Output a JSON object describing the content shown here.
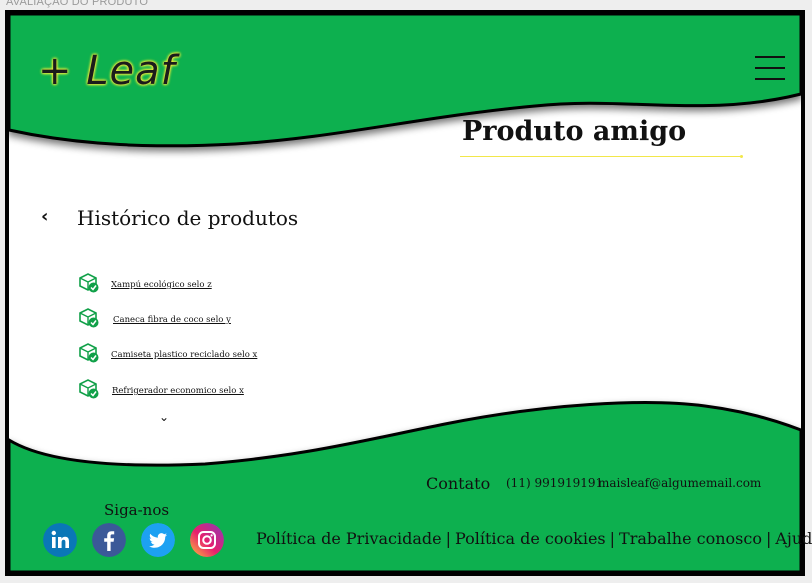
{
  "caption": "AVALIAÇÃO DO PRODUTO",
  "header": {
    "logo": "+ Leaf",
    "menu_icon": "hamburger-menu-icon"
  },
  "main": {
    "title": "Produto amigo",
    "history_title": "Histórico de produtos",
    "items": [
      {
        "label": "Xampú ecológico selo z",
        "icon": "eco-box-check-icon"
      },
      {
        "label": "Caneca fibra de coco selo y",
        "icon": "eco-box-check-icon"
      },
      {
        "label": "Camiseta plastico reciclado selo x",
        "icon": "eco-box-check-icon"
      },
      {
        "label": "Refrigerador economico selo x",
        "icon": "eco-box-check-icon"
      }
    ]
  },
  "footer": {
    "contact_label": "Contato",
    "phone": "(11) 991919191",
    "email": "maisleaf@algumemail.com",
    "follow_label": "Siga-nos",
    "social": [
      "linkedin-icon",
      "facebook-icon",
      "twitter-icon",
      "instagram-icon"
    ],
    "links": [
      "Política de Privacidade",
      "Política de cookies",
      "Trabalhe conosco",
      "Ajuda"
    ],
    "separator": "|"
  },
  "colors": {
    "green": "#10b050",
    "accent_yellow": "#f2e74a",
    "page_bg": "#ffffff",
    "frame": "#000000"
  }
}
